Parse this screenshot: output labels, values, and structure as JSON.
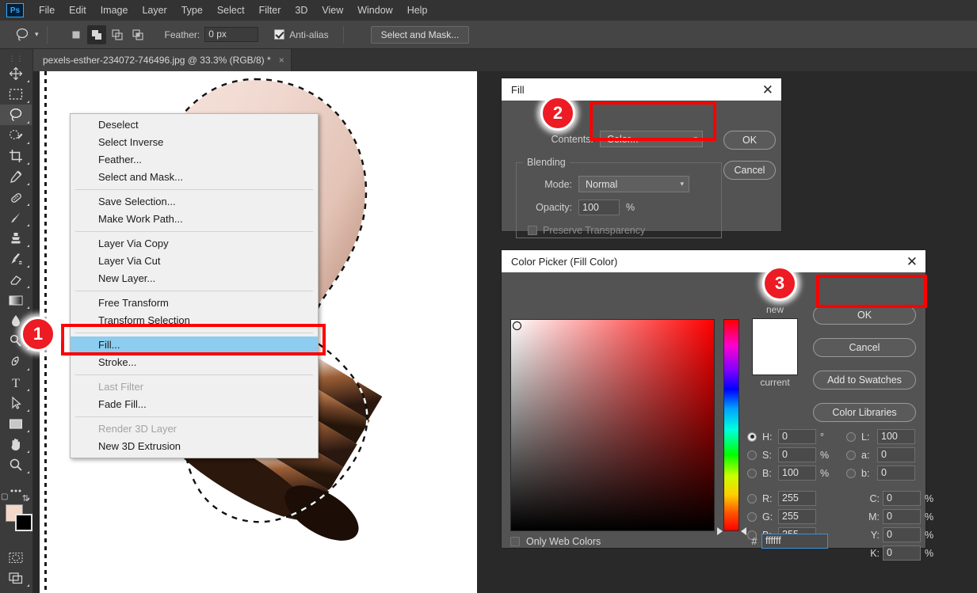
{
  "app": {
    "logo": "Ps",
    "name": "Adobe Photoshop"
  },
  "menubar": {
    "items": [
      "File",
      "Edit",
      "Image",
      "Layer",
      "Type",
      "Select",
      "Filter",
      "3D",
      "View",
      "Window",
      "Help"
    ]
  },
  "options_bar": {
    "tool_icon": "lasso-icon",
    "selection_modes": [
      {
        "name": "new-selection",
        "active": false
      },
      {
        "name": "add-to-selection",
        "active": true
      },
      {
        "name": "subtract-from-selection",
        "active": false
      },
      {
        "name": "intersect-with-selection",
        "active": false
      }
    ],
    "feather_label": "Feather:",
    "feather_value": "0 px",
    "antialias_label": "Anti-alias",
    "antialias_checked": true,
    "select_and_mask_label": "Select and Mask..."
  },
  "document_tab": {
    "title": "pexels-esther-234072-746496.jpg @ 33.3% (RGB/8) *",
    "close": "×"
  },
  "toolbar": {
    "tools": [
      {
        "name": "move-tool",
        "active": false
      },
      {
        "name": "rectangular-marquee-tool",
        "active": false
      },
      {
        "name": "lasso-tool",
        "active": true
      },
      {
        "name": "quick-selection-tool",
        "active": false
      },
      {
        "name": "crop-tool",
        "active": false
      },
      {
        "name": "eyedropper-tool",
        "active": false
      },
      {
        "name": "spot-healing-brush-tool",
        "active": false
      },
      {
        "name": "brush-tool",
        "active": false
      },
      {
        "name": "clone-stamp-tool",
        "active": false
      },
      {
        "name": "history-brush-tool",
        "active": false
      },
      {
        "name": "eraser-tool",
        "active": false
      },
      {
        "name": "gradient-tool",
        "active": false
      },
      {
        "name": "blur-tool",
        "active": false
      },
      {
        "name": "dodge-tool",
        "active": false
      },
      {
        "name": "pen-tool",
        "active": false
      },
      {
        "name": "type-tool",
        "active": false
      },
      {
        "name": "path-selection-tool",
        "active": false
      },
      {
        "name": "rectangle-tool",
        "active": false
      },
      {
        "name": "hand-tool",
        "active": false
      },
      {
        "name": "zoom-tool",
        "active": false
      },
      {
        "name": "edit-toolbar-tool",
        "active": false
      }
    ],
    "foreground_color": "#f2d8c9",
    "background_color": "#000000",
    "quick_mask": "quick-mask-icon",
    "screen_mode": "screen-mode-icon"
  },
  "context_menu": {
    "items": [
      {
        "label": "Deselect",
        "disabled": false,
        "selected": false,
        "separator_after": false
      },
      {
        "label": "Select Inverse",
        "disabled": false,
        "selected": false,
        "separator_after": false
      },
      {
        "label": "Feather...",
        "disabled": false,
        "selected": false,
        "separator_after": false
      },
      {
        "label": "Select and Mask...",
        "disabled": false,
        "selected": false,
        "separator_after": true
      },
      {
        "label": "Save Selection...",
        "disabled": false,
        "selected": false,
        "separator_after": false
      },
      {
        "label": "Make Work Path...",
        "disabled": false,
        "selected": false,
        "separator_after": true
      },
      {
        "label": "Layer Via Copy",
        "disabled": false,
        "selected": false,
        "separator_after": false
      },
      {
        "label": "Layer Via Cut",
        "disabled": false,
        "selected": false,
        "separator_after": false
      },
      {
        "label": "New Layer...",
        "disabled": false,
        "selected": false,
        "separator_after": true
      },
      {
        "label": "Free Transform",
        "disabled": false,
        "selected": false,
        "separator_after": false
      },
      {
        "label": "Transform Selection",
        "disabled": false,
        "selected": false,
        "separator_after": true
      },
      {
        "label": "Fill...",
        "disabled": false,
        "selected": true,
        "separator_after": false
      },
      {
        "label": "Stroke...",
        "disabled": false,
        "selected": false,
        "separator_after": true
      },
      {
        "label": "Last Filter",
        "disabled": true,
        "selected": false,
        "separator_after": false
      },
      {
        "label": "Fade Fill...",
        "disabled": false,
        "selected": false,
        "separator_after": true
      },
      {
        "label": "Render 3D Layer",
        "disabled": true,
        "selected": false,
        "separator_after": false
      },
      {
        "label": "New 3D Extrusion",
        "disabled": false,
        "selected": false,
        "separator_after": false
      }
    ]
  },
  "fill_dialog": {
    "title": "Fill",
    "close": "✕",
    "contents_label": "Contents:",
    "contents_value": "Color...",
    "blending_legend": "Blending",
    "mode_label": "Mode:",
    "mode_value": "Normal",
    "opacity_label": "Opacity:",
    "opacity_value": "100",
    "opacity_unit": "%",
    "preserve_transparency_label": "Preserve Transparency",
    "preserve_transparency_checked": false,
    "ok_label": "OK",
    "cancel_label": "Cancel"
  },
  "color_picker": {
    "title": "Color Picker (Fill Color)",
    "close": "✕",
    "new_label": "new",
    "current_label": "current",
    "swatch_color": "#ffffff",
    "buttons": [
      "OK",
      "Cancel",
      "Add to Swatches",
      "Color Libraries"
    ],
    "only_web_colors_label": "Only Web Colors",
    "only_web_colors_checked": false,
    "hex_symbol": "#",
    "hex_value": "ffffff",
    "hsb": [
      {
        "key": "H:",
        "value": "0",
        "unit": "°",
        "selected": true
      },
      {
        "key": "S:",
        "value": "0",
        "unit": "%",
        "selected": false
      },
      {
        "key": "B:",
        "value": "100",
        "unit": "%",
        "selected": false
      }
    ],
    "rgb": [
      {
        "key": "R:",
        "value": "255",
        "unit": "",
        "selected": false
      },
      {
        "key": "G:",
        "value": "255",
        "unit": "",
        "selected": false
      },
      {
        "key": "B:",
        "value": "255",
        "unit": "",
        "selected": false
      }
    ],
    "lab": [
      {
        "key": "L:",
        "value": "100",
        "unit": "",
        "selected": false
      },
      {
        "key": "a:",
        "value": "0",
        "unit": "",
        "selected": false
      },
      {
        "key": "b:",
        "value": "0",
        "unit": "",
        "selected": false
      }
    ],
    "cmyk": [
      {
        "key": "C:",
        "value": "0",
        "unit": "%"
      },
      {
        "key": "M:",
        "value": "0",
        "unit": "%"
      },
      {
        "key": "Y:",
        "value": "0",
        "unit": "%"
      },
      {
        "key": "K:",
        "value": "0",
        "unit": "%"
      }
    ]
  },
  "annotations": {
    "badges": [
      {
        "number": "1",
        "target": "context-menu-fill-item"
      },
      {
        "number": "2",
        "target": "fill-contents-dropdown"
      },
      {
        "number": "3",
        "target": "color-picker-ok-button"
      }
    ],
    "highlight_color": "#ff0000"
  },
  "canvas": {
    "image_subject": "light-bulb",
    "selection_active": true,
    "background": "#ffffff"
  }
}
